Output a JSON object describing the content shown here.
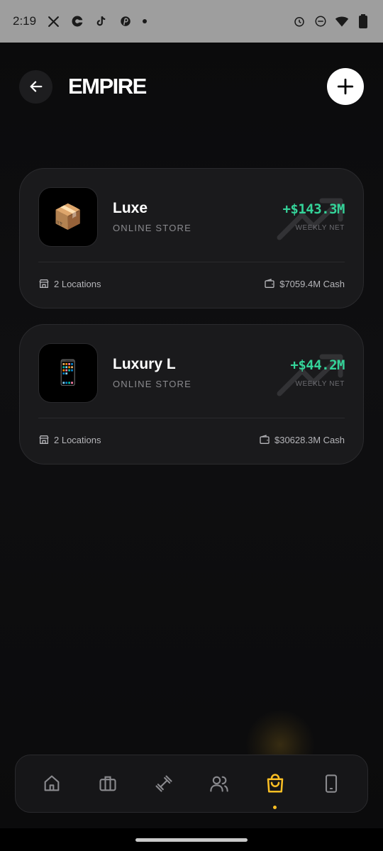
{
  "status_bar": {
    "time": "2:19",
    "left_icons": [
      "x-icon",
      "threads-icon",
      "tiktok-icon",
      "pinterest-icon",
      "dot-icon"
    ],
    "right_icons": [
      "alarm-icon",
      "do-not-disturb-icon",
      "wifi-icon",
      "battery-icon"
    ]
  },
  "header": {
    "title": "EMPIRE"
  },
  "stores": [
    {
      "name": "Luxe",
      "type": "ONLINE STORE",
      "emoji": "📦",
      "icon": "package-icon",
      "net": "+$143.3M",
      "net_label": "WEEKLY NET",
      "locations": "2 Locations",
      "cash": "$7059.4M Cash"
    },
    {
      "name": "Luxury L",
      "type": "ONLINE STORE",
      "emoji": "📱",
      "icon": "phone-icon",
      "net": "+$44.2M",
      "net_label": "WEEKLY NET",
      "locations": "2 Locations",
      "cash": "$30628.3M Cash"
    }
  ],
  "nav": {
    "items": [
      "home",
      "briefcase",
      "dumbbell",
      "users",
      "shopping-bag",
      "tablet"
    ],
    "active": "shopping-bag"
  },
  "colors": {
    "accent": "#fbbf24",
    "positive": "#34d399",
    "card": "#1a1a1c"
  }
}
